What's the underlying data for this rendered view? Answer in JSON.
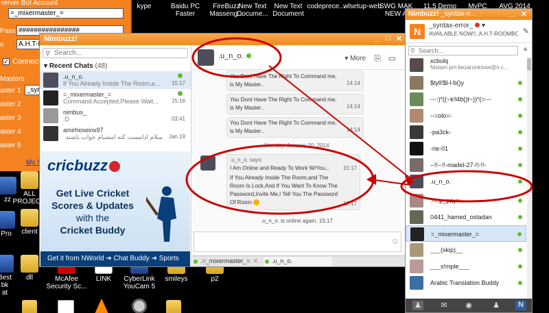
{
  "desktop": {
    "top_labels": [
      "kype",
      "Baidu PC\nFaster",
      "FireBuzz\nMasseng...",
      "New Text\nDocume...",
      "New Text\nDocument",
      "codeprece...",
      "wlsetup-web",
      "SWG MAK\nNEW A"
    ],
    "top_right_labels": [
      "11.5 Demo",
      "MyPC",
      "AVG 2014"
    ],
    "icons": [
      {
        "label": "zz"
      },
      {
        "label": "ALL\nPROJEC..."
      },
      {
        "label": "Pro"
      },
      {
        "label": "client"
      },
      {
        "label": "Best\nbk\nat"
      },
      {
        "label": "dll"
      },
      {
        "label": "McAfee\nSecurity Sc..."
      },
      {
        "label": "LINK"
      },
      {
        "label": "CyberLink\nYouCam 5"
      },
      {
        "label": "smileys"
      },
      {
        "label": "p2"
      }
    ]
  },
  "bot": {
    "title": "rerver Bot Account",
    "field1": "=_mixermaster_=",
    "pass_label": "Pass",
    "pass": "################",
    "field3_label": "e",
    "field3": "A.H.T-R",
    "connect_label": "Connect",
    "masters_label": "Masters",
    "masters": [
      "aster 1",
      "aster 2",
      "aster 3",
      "aster 4",
      "aster 5"
    ],
    "master1_value": "_syn",
    "link": "My S"
  },
  "chat": {
    "title": "Nimbuzz!",
    "search_placeholder": "Search...",
    "recent_label": "Recent Chats",
    "recent_count": "(48)",
    "items": [
      {
        "name": ".u_n_o.",
        "msg": "If You Already Inside The Room,a...",
        "time": "15:17",
        "online": true
      },
      {
        "name": "=_mixermaster_=",
        "msg": "Command Accepted,Please Wait...",
        "time": "15:16",
        "online": true
      },
      {
        "name": "nimbus_",
        "msg": ":D",
        "time": "03:41",
        "online": false
      },
      {
        "name": "amirhoseinx97",
        "msg": "سلام ادامست کته امشیام خواب باشته",
        "time": "Jan 19",
        "online": false
      }
    ],
    "ad": {
      "logo": "cricbuzz",
      "line1": "Get ",
      "line1b": "Live Cricket",
      "line2": "Scores & Updates",
      "line3": "with the",
      "line4": "Cricket Buddy",
      "foot": "Get it from NWorld ➔ Chat Buddy ➔ Sports"
    },
    "contact_name": ".u_n_o.",
    "more_label": "More",
    "messages": [
      {
        "text": "You Dont Have The Right To Command me,",
        "time": "14:14"
      },
      {
        "text": "is My Master..",
        "time": ""
      },
      {
        "text": "You Dont Have The Right To Command me,",
        "time": "14:14"
      },
      {
        "text": "is My Master..",
        "time": ""
      },
      {
        "text": "You Dont Have The Right To Command me,",
        "time": "14:14"
      },
      {
        "text": "is My Master..",
        "time": ""
      }
    ],
    "date_sep": "Monday, January 20, 2014",
    "says": ".u_n_o. says:",
    "m1": "I Am Online and Ready To Work W/You...",
    "m1_time": "15:17",
    "m2a": "If You Already Inside The Room,and The",
    "m2b": "Room Is Lock,And If You Want To Know The",
    "m2c": "Password,Invite Me,I Tell You The Password",
    "m2d": "Of Room",
    "m2_time": "15:17",
    "status": ".u_n_o. is online again.  15:17",
    "tabs": [
      ".=_mixermaster_=",
      ".u_n_o."
    ]
  },
  "contacts": {
    "title": "Nimbuzz!",
    "title_sub": "_syntax-e...",
    "me_name": "_syntax-error_",
    "me_status": "AVAILABLE NOW!!..A.H.T-ROOMBOT",
    "search_placeholder": "Search...",
    "list": [
      {
        "name": "xcbulq",
        "sub": "Nistam pm bezarunknow@n.c...",
        "online": false
      },
      {
        "name": "$tyll!$l-l-b()y",
        "sub": "",
        "online": true
      },
      {
        "name": "---:)*((~k!l4b()t~))*(=---",
        "sub": "",
        "online": true
      },
      {
        "name": "--=olo=-",
        "sub": "",
        "online": true
      },
      {
        "name": "-pa3ck-",
        "sub": "",
        "online": true
      },
      {
        "name": "-rie-01",
        "sub": "",
        "online": true
      },
      {
        "name": "--!!--!!-madel-27-!!-!!-",
        "sub": "",
        "online": true
      },
      {
        "name": ".u_n_o.",
        "sub": "",
        "online": true
      },
      {
        "name": ".-=.p_pay=-.",
        "sub": "",
        "online": true
      },
      {
        "name": "0441_hamed_ostadan",
        "sub": "",
        "online": true
      },
      {
        "name": "=_mixermaster_=",
        "sub": "",
        "online": true
      },
      {
        "name": "___(skip)__",
        "sub": "",
        "online": true
      },
      {
        "name": "___s!mple___",
        "sub": "",
        "online": true
      },
      {
        "name": "Arabic Translation Buddy",
        "sub": "",
        "online": true
      }
    ]
  }
}
